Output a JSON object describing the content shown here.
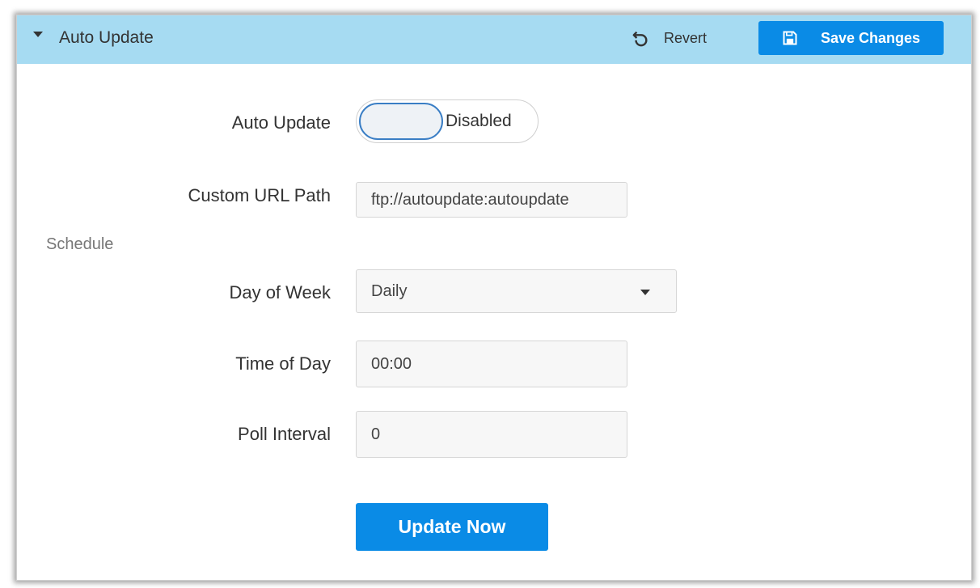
{
  "header": {
    "title": "Auto Update",
    "revert_label": "Revert",
    "save_label": "Save Changes"
  },
  "form": {
    "auto_update": {
      "label": "Auto Update",
      "state": "Disabled",
      "enabled": false
    },
    "custom_url": {
      "label": "Custom URL Path",
      "value": "ftp://autoupdate:autoupdate"
    },
    "schedule": {
      "section_label": "Schedule",
      "day_of_week": {
        "label": "Day of Week",
        "value": "Daily"
      },
      "time_of_day": {
        "label": "Time of Day",
        "value": "00:00"
      },
      "poll_interval": {
        "label": "Poll Interval",
        "value": "0"
      }
    },
    "update_now_label": "Update Now"
  },
  "colors": {
    "header_bg": "#a6dbf2",
    "primary": "#0a8be6",
    "toggle_border": "#3a7ec5"
  },
  "icons": {
    "collapse": "caret-down-icon",
    "revert": "undo-icon",
    "save": "floppy-disk-icon",
    "dropdown": "chevron-down-icon"
  }
}
